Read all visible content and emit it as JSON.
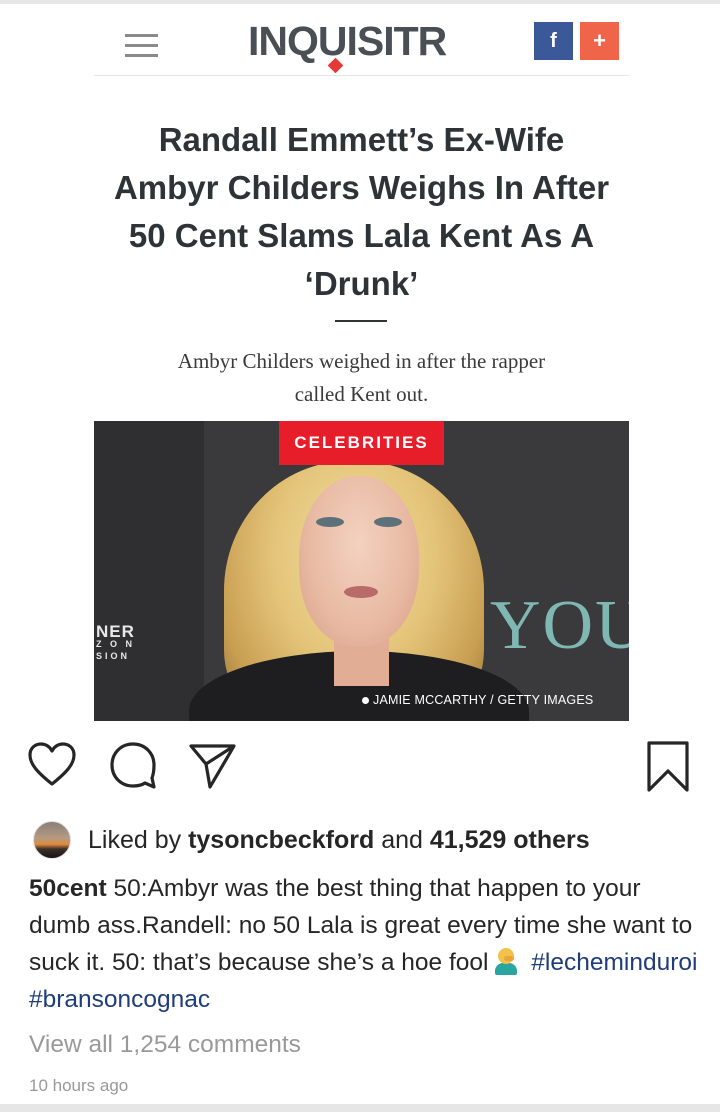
{
  "article": {
    "site_logo": "INQUISITR",
    "share": {
      "facebook": "f",
      "plus": "+"
    },
    "headline": "Randall Emmett’s Ex-Wife Ambyr Childers Weighs In After 50 Cent Slams Lala Kent As A ‘Drunk’",
    "subheadline": "Ambyr Childers weighed in after the rapper called Kent out.",
    "category": "CELEBRITIES",
    "photo_credit": "JAMIE MCCARTHY / GETTY IMAGES",
    "backdrop_text_left_1": "NER",
    "backdrop_text_left_2": "Z O N",
    "backdrop_text_left_3": "SION",
    "backdrop_text_right": "YOU"
  },
  "post": {
    "icons": [
      "heart-icon",
      "comment-icon",
      "share-icon",
      "bookmark-icon"
    ],
    "likes": {
      "prefix": "Liked by",
      "user": "tysoncbeckford",
      "middle": "and",
      "count": "41,529 others"
    },
    "caption": {
      "username": "50cent",
      "text": "50:Ambyr was the best thing that happen to your dumb ass.Randell: no 50 Lala is great every time she want to suck it. 50: that’s because she’s a hoe fool",
      "hashtag_1": "#lecheminduroi",
      "hashtag_2": "#bransoncognac"
    },
    "view_all_comments": "View all 1,254 comments",
    "timestamp": "10 hours ago"
  },
  "colors": {
    "category_red": "#e81d2a",
    "facebook_blue": "#3b5998",
    "plus_orange": "#f06449",
    "hashtag_blue": "#1f3d7a",
    "muted_gray": "#999999"
  }
}
